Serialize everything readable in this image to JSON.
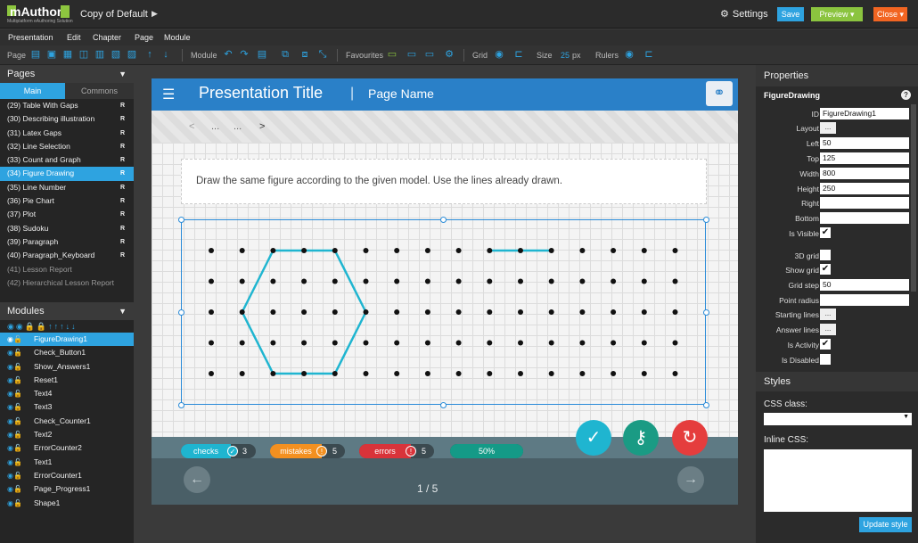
{
  "app": {
    "logo_text": "mAuthor",
    "logo_sub": "Multiplatform eAuthoring Solution",
    "doc_title": "Copy of Default",
    "settings_label": "Settings",
    "save_label": "Save",
    "preview_label": "Preview",
    "close_label": "Close"
  },
  "menu": [
    "Presentation",
    "Edit",
    "Chapter",
    "Page",
    "Module"
  ],
  "toolbar": {
    "page_label": "Page",
    "module_label": "Module",
    "favourites_label": "Favourites",
    "grid_label": "Grid",
    "size_label": "Size",
    "size_value": "25",
    "size_unit": "px",
    "rulers_label": "Rulers"
  },
  "pages_panel": {
    "title": "Pages",
    "tab_main": "Main",
    "tab_commons": "Commons",
    "items": [
      {
        "label": "(29) Table With Gaps",
        "flag": "R"
      },
      {
        "label": "(30) Describing illustration",
        "flag": "R"
      },
      {
        "label": "(31) Latex Gaps",
        "flag": "R"
      },
      {
        "label": "(32) Line Selection",
        "flag": "R"
      },
      {
        "label": "(33) Count and Graph",
        "flag": "R"
      },
      {
        "label": "(34) Figure Drawing",
        "flag": "R"
      },
      {
        "label": "(35) Line Number",
        "flag": "R"
      },
      {
        "label": "(36) Pie Chart",
        "flag": "R"
      },
      {
        "label": "(37) Plot",
        "flag": "R"
      },
      {
        "label": "(38) Sudoku",
        "flag": "R"
      },
      {
        "label": "(39) Paragraph",
        "flag": "R"
      },
      {
        "label": "(40) Paragraph_Keyboard",
        "flag": "R"
      },
      {
        "label": "(41) Lesson Report",
        "flag": ""
      },
      {
        "label": "(42) Hierarchical Lesson Report",
        "flag": ""
      }
    ]
  },
  "modules_panel": {
    "title": "Modules",
    "items": [
      "FigureDrawing1",
      "Check_Button1",
      "Show_Answers1",
      "Reset1",
      "Text4",
      "Text3",
      "Check_Counter1",
      "Text2",
      "ErrorCounter2",
      "Text1",
      "ErrorCounter1",
      "Page_Progress1",
      "Shape1"
    ]
  },
  "page": {
    "title": "Presentation Title",
    "divider": "|",
    "name": "Page Name",
    "nav_prev": "<",
    "nav_dots1": "...",
    "nav_dots2": "...",
    "nav_next": ">",
    "instruction": "Draw the same figure according to the given model. Use the lines already drawn.",
    "counters": {
      "checks_label": "checks",
      "checks_value": "3",
      "mistakes_label": "mistakes",
      "mistakes_value": "5",
      "errors_label": "errors",
      "errors_value": "5",
      "progress_label": "50%"
    },
    "page_counter": "1 / 5"
  },
  "properties": {
    "title": "Properties",
    "module": "FigureDrawing",
    "fields": [
      {
        "label": "ID",
        "type": "text",
        "value": "FigureDrawing1"
      },
      {
        "label": "Layout",
        "type": "button",
        "value": "..."
      },
      {
        "label": "Left",
        "type": "text",
        "value": "50"
      },
      {
        "label": "Top",
        "type": "text",
        "value": "125"
      },
      {
        "label": "Width",
        "type": "text",
        "value": "800"
      },
      {
        "label": "Height",
        "type": "text",
        "value": "250"
      },
      {
        "label": "Right",
        "type": "text",
        "value": ""
      },
      {
        "label": "Bottom",
        "type": "text",
        "value": ""
      },
      {
        "label": "Is Visible",
        "type": "check",
        "value": "✔"
      },
      {
        "label": "3D grid",
        "type": "check",
        "value": ""
      },
      {
        "label": "Show grid",
        "type": "check",
        "value": "✔"
      },
      {
        "label": "Grid step",
        "type": "text",
        "value": "50"
      },
      {
        "label": "Point radius",
        "type": "text",
        "value": ""
      },
      {
        "label": "Starting lines",
        "type": "button",
        "value": "..."
      },
      {
        "label": "Answer lines",
        "type": "button",
        "value": "..."
      },
      {
        "label": "Is Activity",
        "type": "check",
        "value": "✔"
      },
      {
        "label": "Is Disabled",
        "type": "check",
        "value": ""
      }
    ]
  },
  "styles": {
    "title": "Styles",
    "css_class_label": "CSS class:",
    "inline_css_label": "Inline CSS:",
    "update_label": "Update style"
  },
  "colors": {
    "accent": "#2ea3e0",
    "figure_line": "#1fb5d0",
    "save": "#2ea3e0",
    "preview": "#8bc43f",
    "close": "#f26522"
  }
}
